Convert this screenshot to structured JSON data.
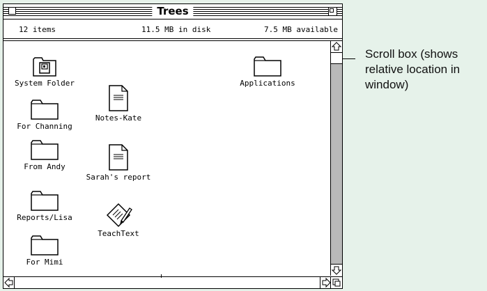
{
  "window": {
    "title": "Trees",
    "info": {
      "items": "12 items",
      "disk": "11.5 MB in disk",
      "available": "7.5 MB available"
    },
    "icons": [
      {
        "label": "System Folder",
        "icon": "system-folder-icon"
      },
      {
        "label": "For Channing",
        "icon": "folder-icon"
      },
      {
        "label": "From Andy",
        "icon": "folder-icon"
      },
      {
        "label": "Reports/Lisa",
        "icon": "folder-icon"
      },
      {
        "label": "For Mimi",
        "icon": "folder-icon"
      },
      {
        "label": "Notes-Kate",
        "icon": "document-icon"
      },
      {
        "label": "Sarah's report",
        "icon": "document-icon"
      },
      {
        "label": "TeachText",
        "icon": "teachtext-app-icon"
      },
      {
        "label": "Applications",
        "icon": "folder-icon"
      }
    ]
  },
  "callout": {
    "text": "Scroll box (shows relative location in window)"
  }
}
